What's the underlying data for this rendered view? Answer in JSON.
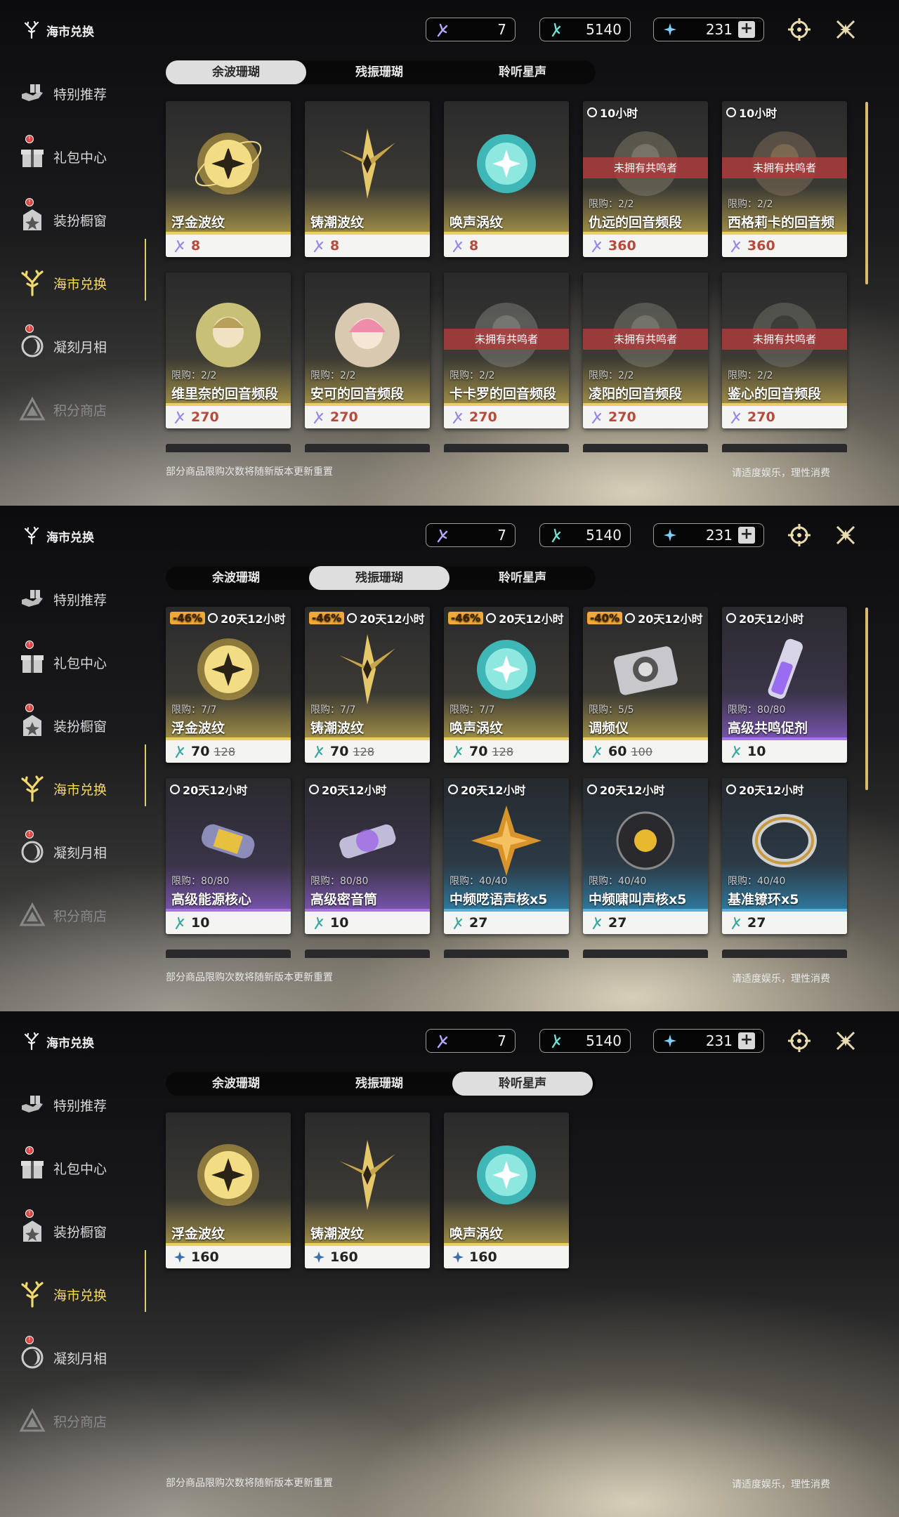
{
  "title": "海市兑换",
  "sidebar": {
    "items": [
      {
        "label": "特别推荐"
      },
      {
        "label": "礼包中心"
      },
      {
        "label": "装扮橱窗"
      },
      {
        "label": "海市兑换"
      },
      {
        "label": "凝刻月相"
      },
      {
        "label": "积分商店"
      }
    ]
  },
  "currencies": [
    {
      "value": "7"
    },
    {
      "value": "5140"
    },
    {
      "value": "231"
    }
  ],
  "plus": "+",
  "tabs": [
    "余波珊瑚",
    "残振珊瑚",
    "聆听星声"
  ],
  "note": "部分商品限购次数将随新版本更新重置",
  "note2": "请适度娱乐，理性消费",
  "colors": {
    "accent": "#e9cf62",
    "tab_active": "#dedede",
    "price_red": "#b84a3c",
    "discount": "#f0a838",
    "banner": "#aa3c3c"
  },
  "panel1": {
    "items": [
      {
        "name": "浮金波纹",
        "price": "8",
        "icon": "gold-orb-icon"
      },
      {
        "name": "铸潮波纹",
        "price": "8",
        "icon": "gold-blade-icon"
      },
      {
        "name": "唤声涡纹",
        "price": "8",
        "icon": "teal-orb-icon"
      },
      {
        "name": "仇远的回音频段",
        "price": "360",
        "timer": "10小时",
        "banner": "未拥有共鸣者",
        "limit": "限购：2/2",
        "icon": "character-portrait-icon"
      },
      {
        "name": "西格莉卡的回音频段",
        "price": "360",
        "timer": "10小时",
        "banner": "未拥有共鸣者",
        "limit": "限购：2/2",
        "icon": "character-portrait-icon"
      },
      {
        "name": "维里奈的回音频段",
        "price": "270",
        "limit": "限购：2/2",
        "icon": "character-portrait-icon"
      },
      {
        "name": "安可的回音频段",
        "price": "270",
        "limit": "限购：2/2",
        "icon": "character-portrait-icon"
      },
      {
        "name": "卡卡罗的回音频段",
        "price": "270",
        "banner": "未拥有共鸣者",
        "limit": "限购：2/2",
        "icon": "character-portrait-icon"
      },
      {
        "name": "凌阳的回音频段",
        "price": "270",
        "banner": "未拥有共鸣者",
        "limit": "限购：2/2",
        "icon": "character-portrait-icon"
      },
      {
        "name": "鉴心的回音频段",
        "price": "270",
        "banner": "未拥有共鸣者",
        "limit": "限购：2/2",
        "icon": "character-portrait-icon"
      }
    ]
  },
  "panel2": {
    "items": [
      {
        "name": "浮金波纹",
        "price": "70",
        "old": "128",
        "disc": "-46%",
        "timer": "20天12小时",
        "limit": "限购：7/7",
        "icon": "gold-orb-icon"
      },
      {
        "name": "铸潮波纹",
        "price": "70",
        "old": "128",
        "disc": "-46%",
        "timer": "20天12小时",
        "limit": "限购：7/7",
        "icon": "gold-blade-icon"
      },
      {
        "name": "唤声涡纹",
        "price": "70",
        "old": "128",
        "disc": "-46%",
        "timer": "20天12小时",
        "limit": "限购：7/7",
        "icon": "teal-orb-icon"
      },
      {
        "name": "调频仪",
        "price": "60",
        "old": "100",
        "disc": "-40%",
        "timer": "20天12小时",
        "limit": "限购：5/5",
        "icon": "tuner-device-icon"
      },
      {
        "name": "高级共鸣促剂",
        "price": "10",
        "timer": "20天12小时",
        "limit": "限购：80/80",
        "icon": "vial-icon"
      },
      {
        "name": "高级能源核心",
        "price": "10",
        "timer": "20天12小时",
        "limit": "限购：80/80",
        "icon": "energy-core-icon"
      },
      {
        "name": "高级密音筒",
        "price": "10",
        "timer": "20天12小时",
        "limit": "限购：80/80",
        "icon": "sealed-tube-icon"
      },
      {
        "name": "中频呓语声核x5",
        "price": "27",
        "timer": "20天12小时",
        "limit": "限购：40/40",
        "icon": "star-core-icon"
      },
      {
        "name": "中频啸叫声核x5",
        "price": "27",
        "timer": "20天12小时",
        "limit": "限购：40/40",
        "icon": "dark-core-icon"
      },
      {
        "name": "基准镣环x5",
        "price": "27",
        "timer": "20天12小时",
        "limit": "限购：40/40",
        "icon": "ring-icon"
      }
    ]
  },
  "panel3": {
    "items": [
      {
        "name": "浮金波纹",
        "price": "160",
        "icon": "gold-orb-icon"
      },
      {
        "name": "铸潮波纹",
        "price": "160",
        "icon": "gold-blade-icon"
      },
      {
        "name": "唤声涡纹",
        "price": "160",
        "icon": "teal-orb-icon"
      }
    ]
  }
}
